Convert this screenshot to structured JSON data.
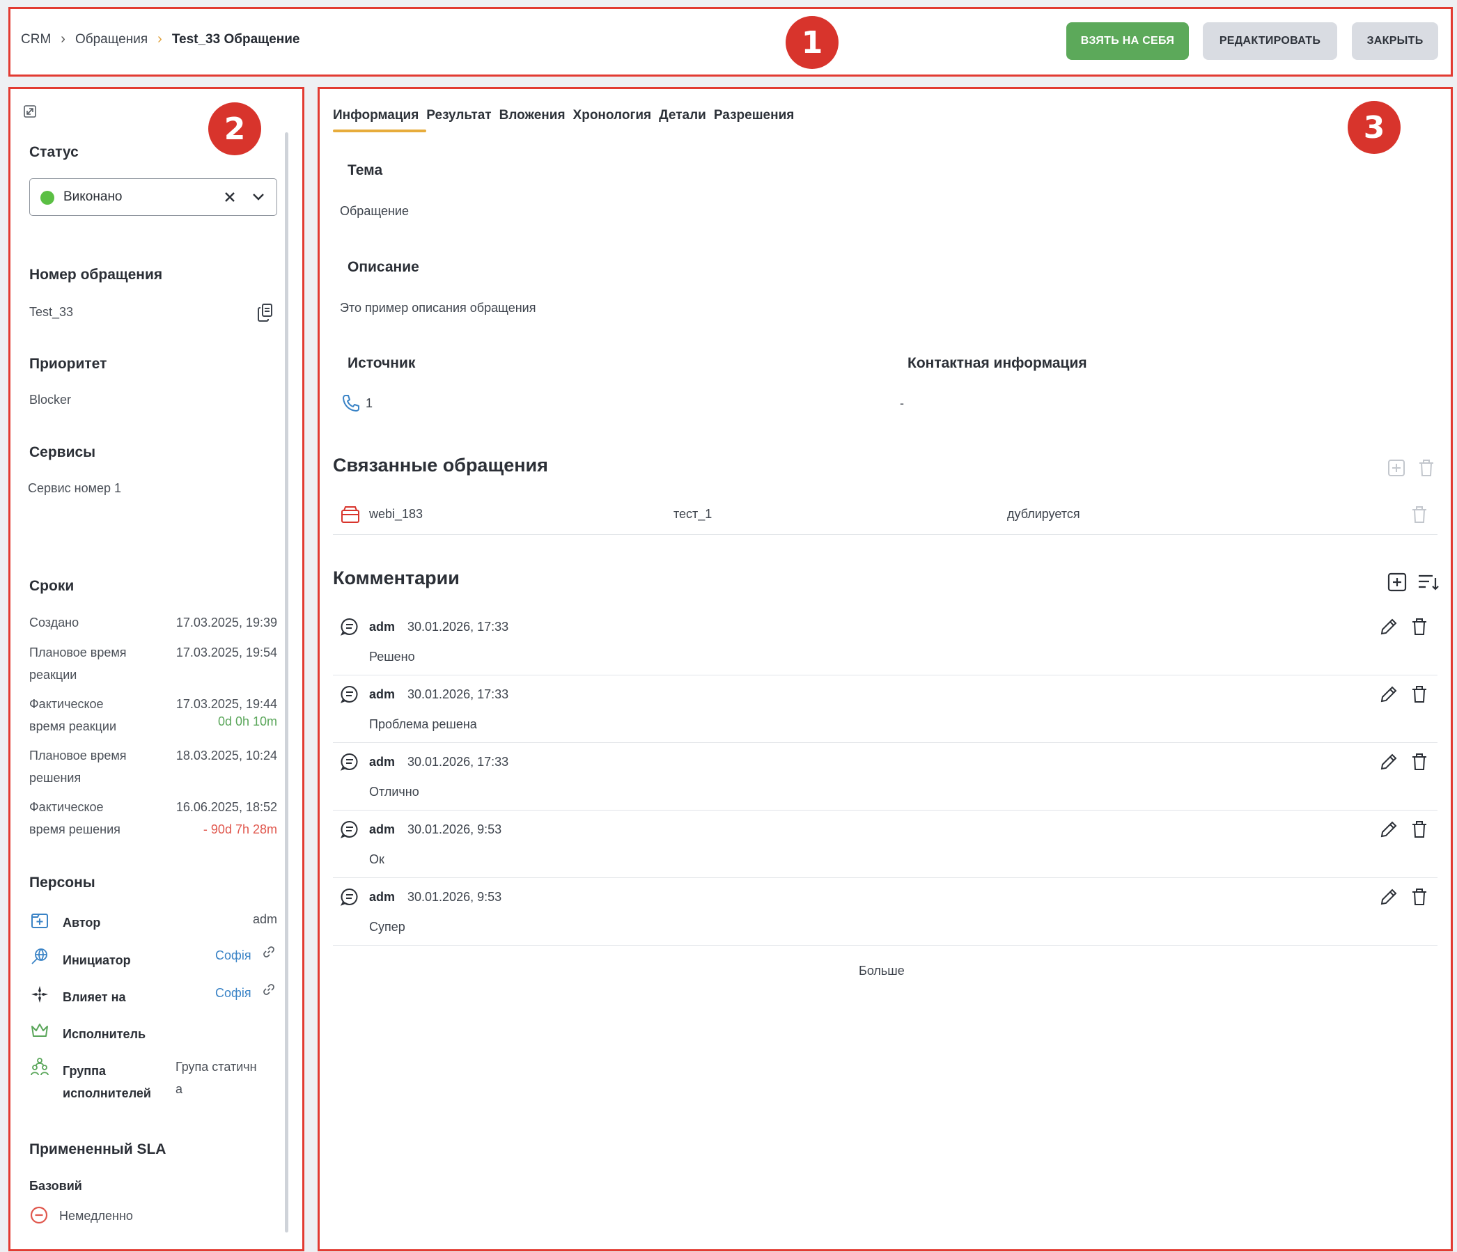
{
  "header": {
    "breadcrumbs": [
      "CRM",
      "Обращения",
      "Test_33 Обращение"
    ],
    "separators": [
      "›",
      "›"
    ],
    "buttons": {
      "take": "ВЗЯТЬ НА СЕБЯ",
      "edit": "РЕДАКТИРОВАТЬ",
      "close": "ЗАКРЫТЬ"
    },
    "badge": "1"
  },
  "left": {
    "badge": "2",
    "status": {
      "label": "Статус",
      "value": "Виконано",
      "dot_color": "#5bbf44"
    },
    "number": {
      "label": "Номер обращения",
      "value": "Test_33"
    },
    "priority": {
      "label": "Приоритет",
      "value": "Blocker"
    },
    "services": {
      "label": "Сервисы",
      "value": "Сервис номер 1"
    },
    "deadlines": {
      "label": "Сроки",
      "created": {
        "label": "Создано",
        "value": "17.03.2025, 19:39"
      },
      "planned_reaction": {
        "label1": "Плановое время",
        "label2": "реакции",
        "value": "17.03.2025, 19:54"
      },
      "actual_reaction": {
        "label1": "Фактическое",
        "label2": "время реакции",
        "value": "17.03.2025, 19:44",
        "delta": "0d 0h 10m",
        "delta_color": "#5aa65a"
      },
      "planned_solution": {
        "label1": "Плановое время",
        "label2": "решения",
        "value": "18.03.2025, 10:24"
      },
      "actual_solution": {
        "label1": "Фактическое",
        "label2": "время решения",
        "value": "16.06.2025, 18:52",
        "delta": "- 90d 7h 28m",
        "delta_color": "#e0574d"
      }
    },
    "persons": {
      "label": "Персоны",
      "author": {
        "label": "Автор",
        "value": "adm"
      },
      "initiator": {
        "label": "Инициатор",
        "value": "Софія"
      },
      "affects": {
        "label": "Влияет на",
        "value": "Софія"
      },
      "executor": {
        "label": "Исполнитель"
      },
      "group": {
        "label1": "Группа",
        "label2": "исполнителей",
        "value1": "Група статичн",
        "value2": "а"
      }
    },
    "sla": {
      "label": "Примененный SLA",
      "name": "Базовий",
      "value": "Немедленно"
    }
  },
  "right": {
    "badge": "3",
    "tabs": [
      "Информация",
      "Результат",
      "Вложения",
      "Хронология",
      "Детали",
      "Разрешения"
    ],
    "topic": {
      "label": "Тема",
      "value": "Обращение"
    },
    "description": {
      "label": "Описание",
      "value": "Это пример описания обращения"
    },
    "source": {
      "label": "Источник",
      "value": "1"
    },
    "contact": {
      "label": "Контактная информация",
      "value": "-"
    },
    "related": {
      "title": "Связанные обращения",
      "item": {
        "id": "webi_183",
        "name": "тест_1",
        "relation": "дублируется"
      }
    },
    "comments": {
      "title": "Комментарии",
      "items": [
        {
          "author": "adm",
          "time": "30.01.2026, 17:33",
          "text": "Решено"
        },
        {
          "author": "adm",
          "time": "30.01.2026, 17:33",
          "text": "Проблема решена"
        },
        {
          "author": "adm",
          "time": "30.01.2026, 17:33",
          "text": "Отлично"
        },
        {
          "author": "adm",
          "time": "30.01.2026, 9:53",
          "text": "Ок"
        },
        {
          "author": "adm",
          "time": "30.01.2026, 9:53",
          "text": "Супер"
        }
      ],
      "more": "Больше"
    }
  }
}
